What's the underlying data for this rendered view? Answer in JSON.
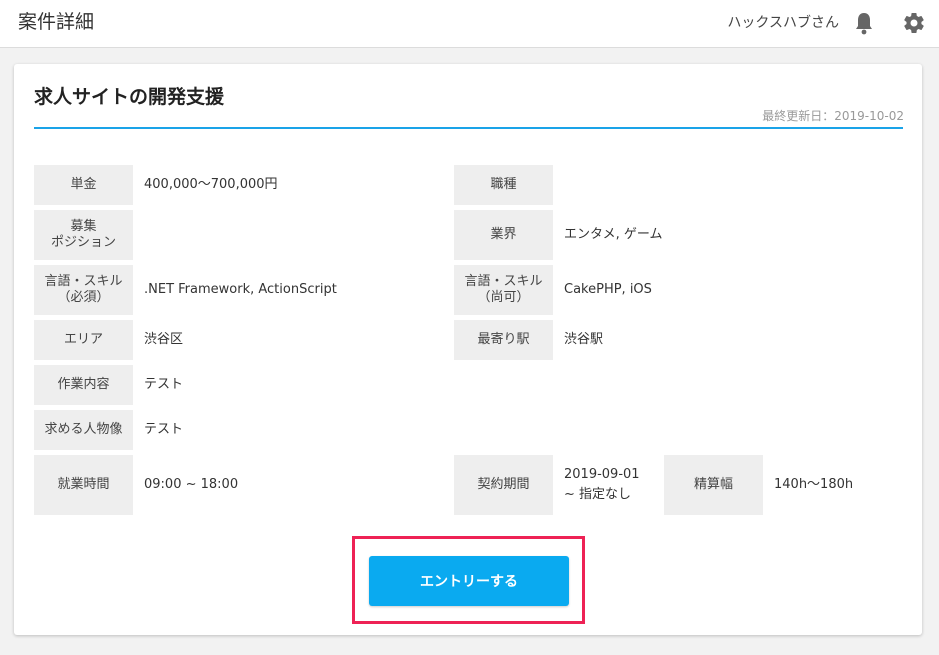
{
  "header": {
    "title": "案件詳細",
    "user_name": "ハックスハブさん",
    "bell_icon": "bell-icon",
    "settings_icon": "gear-icon"
  },
  "job": {
    "title": "求人サイトの開発支援",
    "updated": "最終更新日：2019-10-02"
  },
  "details": {
    "rate": {
      "label": "単金",
      "value": "400,000〜700,000円"
    },
    "job_type": {
      "label": "職種",
      "value": ""
    },
    "position": {
      "label": "募集\nポジション",
      "value": ""
    },
    "industry": {
      "label": "業界",
      "value": "エンタメ, ゲーム"
    },
    "skills_required": {
      "label": "言語・スキル\n（必須）",
      "value": ".NET Framework, ActionScript"
    },
    "skills_optional": {
      "label": "言語・スキル\n（尚可）",
      "value": "CakePHP, iOS"
    },
    "area": {
      "label": "エリア",
      "value": "渋谷区"
    },
    "station": {
      "label": "最寄り駅",
      "value": "渋谷駅"
    },
    "work_content": {
      "label": "作業内容",
      "value": "テスト"
    },
    "ideal_candidate": {
      "label": "求める人物像",
      "value": "テスト"
    },
    "work_hours": {
      "label": "就業時間",
      "value": "09:00 ~ 18:00"
    },
    "contract_period": {
      "label": "契約期間",
      "value": "2019-09-01\n~ 指定なし"
    },
    "settlement": {
      "label": "精算幅",
      "value": "140h〜180h"
    }
  },
  "entry_button": {
    "label": "エントリーする"
  },
  "colors": {
    "accent": "#1aa3e8",
    "button": "#0aaaf0",
    "highlight": "#ee2255",
    "label_bg": "#eeeeee"
  }
}
